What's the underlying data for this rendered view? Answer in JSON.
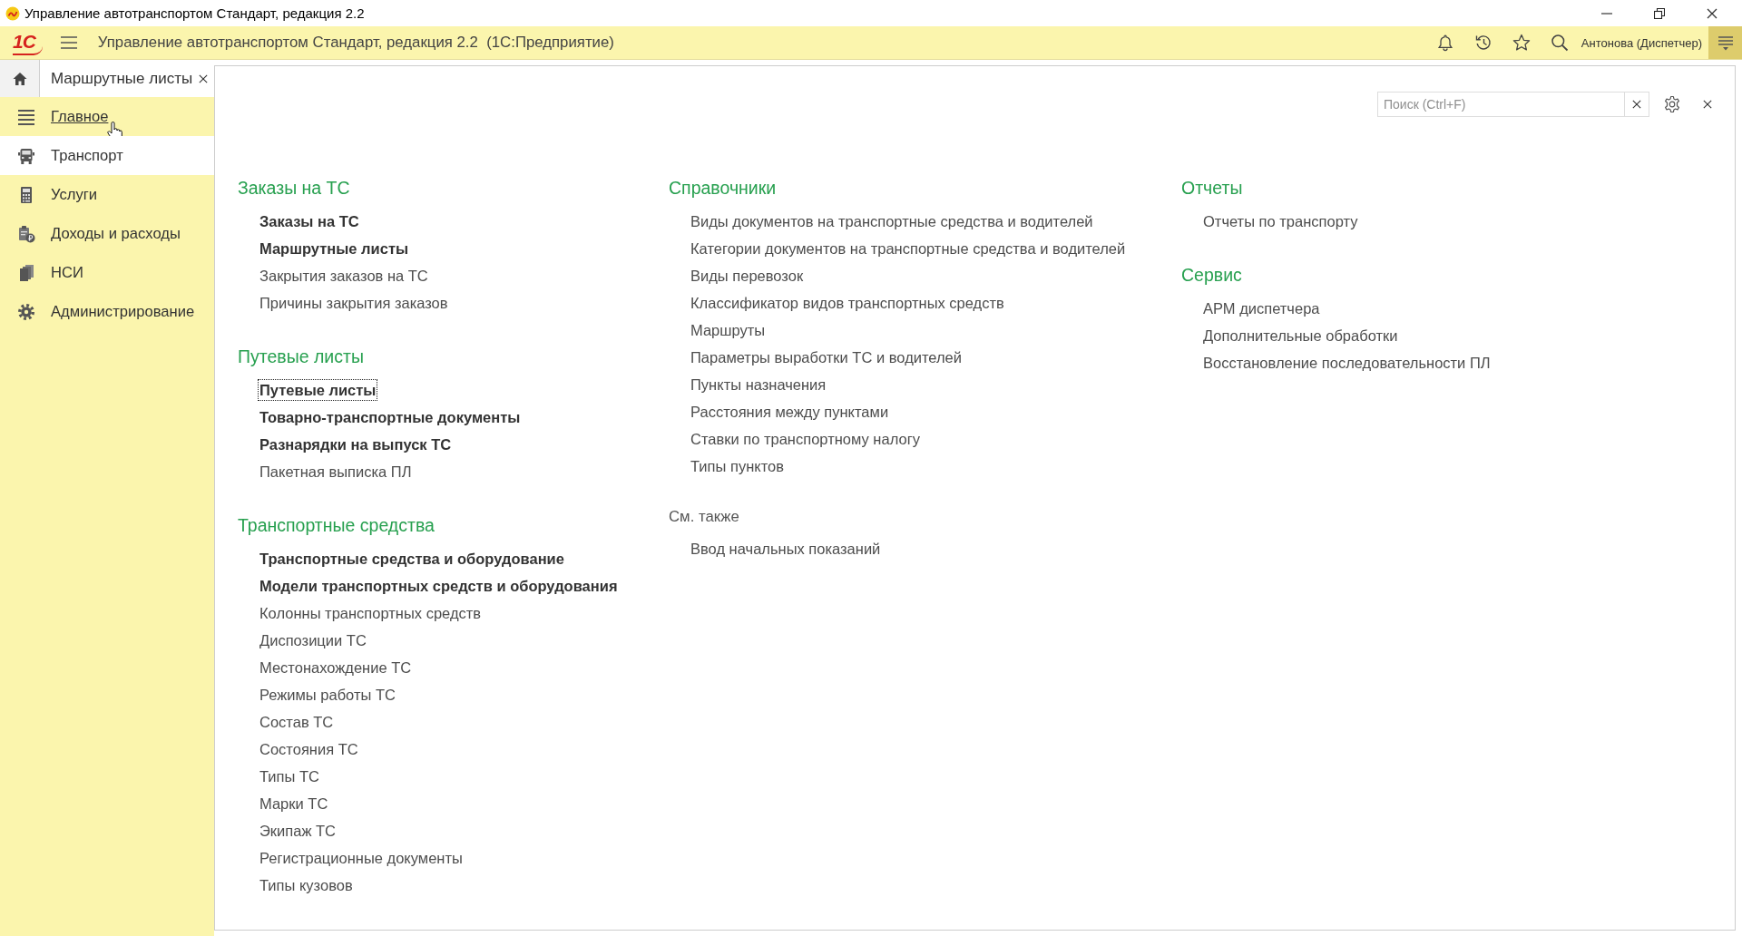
{
  "window": {
    "title": "Управление автотранспортом Стандарт, редакция 2.2"
  },
  "app_bar": {
    "logo": "1С",
    "title": "Управление автотранспортом Стандарт, редакция 2.2  (1С:Предприятие)",
    "user": "Антонова (Диспетчер)"
  },
  "tabs": [
    {
      "label": "Маршрутные листы",
      "selected": true
    }
  ],
  "sections": [
    {
      "label": "Главное",
      "selected": false,
      "hovered": true
    },
    {
      "label": "Транспорт",
      "selected": true,
      "hovered": false
    },
    {
      "label": "Услуги",
      "selected": false,
      "hovered": false
    },
    {
      "label": "Доходы и расходы",
      "selected": false,
      "hovered": false
    },
    {
      "label": "НСИ",
      "selected": false,
      "hovered": false
    },
    {
      "label": "Администрирование",
      "selected": false,
      "hovered": false
    }
  ],
  "panel": {
    "search": {
      "placeholder": "Поиск (Ctrl+F)"
    },
    "columns": [
      {
        "groups": [
          {
            "kind": "section",
            "title": "Заказы на ТС",
            "items": [
              {
                "label": "Заказы на ТС",
                "emphasized": true,
                "focused": false
              },
              {
                "label": "Маршрутные листы",
                "emphasized": true,
                "focused": false
              },
              {
                "label": "Закрытия заказов на ТС",
                "emphasized": false,
                "focused": false
              },
              {
                "label": "Причины закрытия заказов",
                "emphasized": false,
                "focused": false
              }
            ]
          },
          {
            "kind": "section",
            "title": "Путевые листы",
            "items": [
              {
                "label": "Путевые листы",
                "emphasized": true,
                "focused": true
              },
              {
                "label": "Товарно-транспортные документы",
                "emphasized": true,
                "focused": false
              },
              {
                "label": "Разнарядки на выпуск ТС",
                "emphasized": true,
                "focused": false
              },
              {
                "label": "Пакетная выписка ПЛ",
                "emphasized": false,
                "focused": false
              }
            ]
          },
          {
            "kind": "section",
            "title": "Транспортные средства",
            "items": [
              {
                "label": "Транспортные средства и оборудование",
                "emphasized": true,
                "focused": false
              },
              {
                "label": "Модели транспортных средств и оборудования",
                "emphasized": true,
                "focused": false
              },
              {
                "label": "Колонны транспортных средств",
                "emphasized": false,
                "focused": false
              },
              {
                "label": "Диспозиции ТС",
                "emphasized": false,
                "focused": false
              },
              {
                "label": "Местонахождение ТС",
                "emphasized": false,
                "focused": false
              },
              {
                "label": "Режимы работы ТС",
                "emphasized": false,
                "focused": false
              },
              {
                "label": "Состав ТС",
                "emphasized": false,
                "focused": false
              },
              {
                "label": "Состояния ТС",
                "emphasized": false,
                "focused": false
              },
              {
                "label": "Типы ТС",
                "emphasized": false,
                "focused": false
              },
              {
                "label": "Марки ТС",
                "emphasized": false,
                "focused": false
              },
              {
                "label": "Экипаж ТС",
                "emphasized": false,
                "focused": false
              },
              {
                "label": "Регистрационные документы",
                "emphasized": false,
                "focused": false
              },
              {
                "label": "Типы кузовов",
                "emphasized": false,
                "focused": false
              }
            ]
          }
        ]
      },
      {
        "groups": [
          {
            "kind": "section",
            "title": "Справочники",
            "items": [
              {
                "label": "Виды документов на транспортные средства и водителей",
                "emphasized": false,
                "focused": false
              },
              {
                "label": "Категории документов на транспортные средства и водителей",
                "emphasized": false,
                "focused": false
              },
              {
                "label": "Виды перевозок",
                "emphasized": false,
                "focused": false
              },
              {
                "label": "Классификатор видов транспортных средств",
                "emphasized": false,
                "focused": false
              },
              {
                "label": "Маршруты",
                "emphasized": false,
                "focused": false
              },
              {
                "label": "Параметры выработки ТС и водителей",
                "emphasized": false,
                "focused": false
              },
              {
                "label": "Пункты назначения",
                "emphasized": false,
                "focused": false
              },
              {
                "label": "Расстояния между пунктами",
                "emphasized": false,
                "focused": false
              },
              {
                "label": "Ставки по транспортному налогу",
                "emphasized": false,
                "focused": false
              },
              {
                "label": "Типы пунктов",
                "emphasized": false,
                "focused": false
              }
            ]
          },
          {
            "kind": "see_also",
            "title": "См. также",
            "items": [
              {
                "label": "Ввод начальных показаний",
                "emphasized": false,
                "focused": false
              }
            ]
          }
        ]
      },
      {
        "groups": [
          {
            "kind": "section",
            "title": "Отчеты",
            "items": [
              {
                "label": "Отчеты по транспорту",
                "emphasized": false,
                "focused": false
              }
            ]
          },
          {
            "kind": "section",
            "title": "Сервис",
            "items": [
              {
                "label": "АРМ диспетчера",
                "emphasized": false,
                "focused": false
              },
              {
                "label": "Дополнительные обработки",
                "emphasized": false,
                "focused": false
              },
              {
                "label": "Восстановление последовательности ПЛ",
                "emphasized": false,
                "focused": false
              }
            ]
          }
        ]
      }
    ]
  }
}
